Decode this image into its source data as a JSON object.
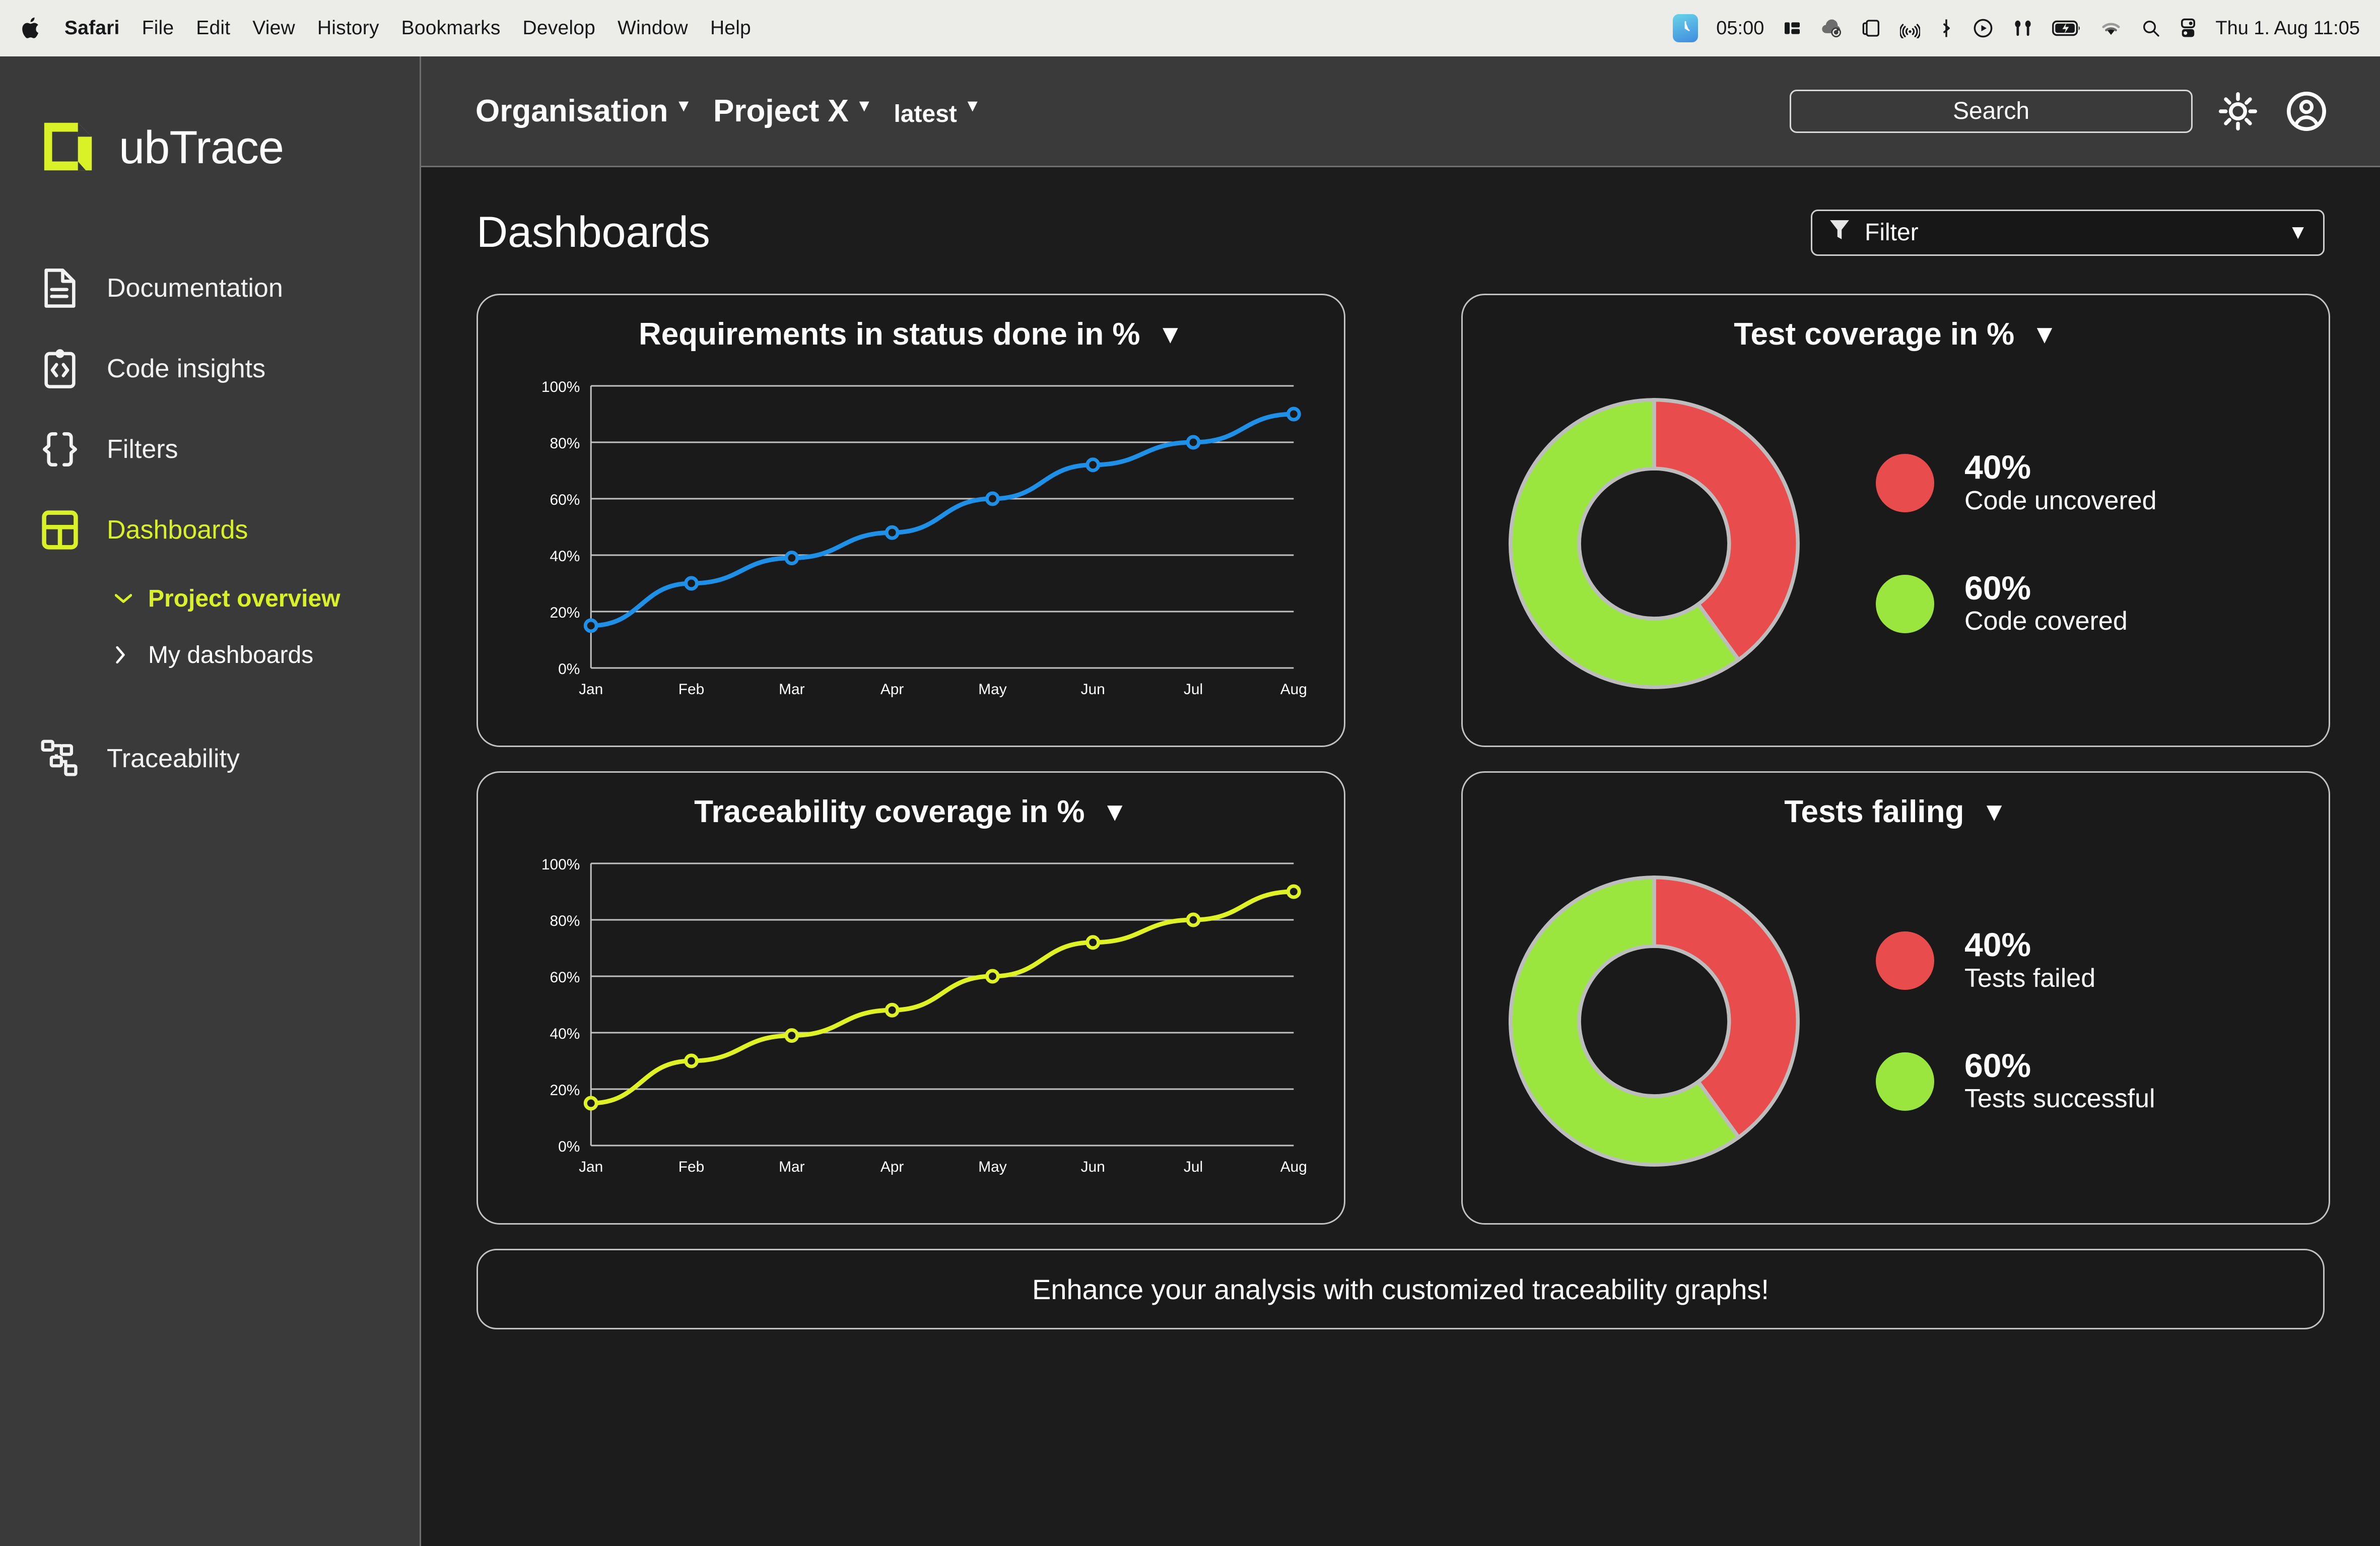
{
  "menubar": {
    "apple_icon": "apple-icon",
    "items": [
      {
        "label": "Safari",
        "bold": true
      },
      {
        "label": "File",
        "bold": false
      },
      {
        "label": "Edit",
        "bold": false
      },
      {
        "label": "View",
        "bold": false
      },
      {
        "label": "History",
        "bold": false
      },
      {
        "label": "Bookmarks",
        "bold": false
      },
      {
        "label": "Develop",
        "bold": false
      },
      {
        "label": "Window",
        "bold": false
      },
      {
        "label": "Help",
        "bold": false
      }
    ],
    "status": {
      "timer_value": "05:00",
      "icons": [
        "stage-manager-icon",
        "cloud-sync-icon",
        "screen-mirroring-icon",
        "airplay-icon",
        "bluetooth-icon",
        "now-playing-icon",
        "airpods-icon",
        "battery-charging-icon",
        "wifi-icon",
        "spotlight-search-icon",
        "control-center-icon"
      ],
      "datetime": "Thu 1. Aug 11:05"
    }
  },
  "brand": {
    "name": "ubTrace",
    "logo_icon": "ubtrace-cube-logo",
    "accent_color": "#d9f227"
  },
  "sidebar": {
    "items": [
      {
        "label": "Documentation",
        "icon": "document-icon",
        "active": false
      },
      {
        "label": "Code insights",
        "icon": "code-clipboard-icon",
        "active": false
      },
      {
        "label": "Filters",
        "icon": "curly-braces-icon",
        "active": false
      },
      {
        "label": "Dashboards",
        "icon": "dashboard-grid-icon",
        "active": true
      },
      {
        "label": "Traceability",
        "icon": "node-graph-icon",
        "active": false
      }
    ],
    "dashboards_children": [
      {
        "label": "Project overview",
        "chevron": "chevron-down-icon",
        "active": true
      },
      {
        "label": "My dashboards",
        "chevron": "chevron-right-icon",
        "active": false
      }
    ]
  },
  "topbar": {
    "breadcrumbs": [
      {
        "label": "Organisation",
        "caret": "caret-down-icon",
        "size": "large"
      },
      {
        "label": "Project X",
        "caret": "caret-down-icon",
        "size": "large"
      },
      {
        "label": "latest",
        "caret": "caret-down-icon",
        "size": "small"
      }
    ],
    "search_placeholder": "Search",
    "search_value": "",
    "theme_toggle_icon": "sun-icon",
    "account_icon": "account-avatar-icon"
  },
  "main": {
    "page_title": "Dashboards",
    "filter": {
      "label": "Filter",
      "icon": "funnel-icon",
      "caret": "caret-down-icon"
    },
    "banner_text": "Enhance your analysis with customized traceability graphs!"
  },
  "cards": {
    "requirements": {
      "title": "Requirements in status done in %",
      "caret": "caret-down-icon"
    },
    "test_coverage": {
      "title": "Test coverage in %",
      "caret": "caret-down-icon"
    },
    "traceability": {
      "title": "Traceability coverage in %",
      "caret": "caret-down-icon"
    },
    "tests_failing": {
      "title": "Tests failing",
      "caret": "caret-down-icon"
    }
  },
  "chart_data": [
    {
      "type": "line",
      "id": "requirements",
      "title": "Requirements in status done in %",
      "xlabel": "",
      "ylabel": "",
      "categories": [
        "Jan",
        "Feb",
        "Mar",
        "Apr",
        "May",
        "Jun",
        "Jul",
        "Aug"
      ],
      "values": [
        15,
        30,
        39,
        48,
        60,
        72,
        80,
        90
      ],
      "ytick_labels": [
        "0%",
        "20%",
        "40%",
        "60%",
        "80%",
        "100%"
      ],
      "yticks": [
        0,
        20,
        40,
        60,
        80,
        100
      ],
      "ylim": [
        0,
        100
      ],
      "grid": true,
      "legend": "none",
      "color": "#1e90e8",
      "marker": "open-circle"
    },
    {
      "type": "pie",
      "id": "test_coverage",
      "title": "Test coverage in %",
      "donut": true,
      "labels": [
        "Code uncovered",
        "Code covered"
      ],
      "values": [
        40,
        60
      ],
      "value_labels": [
        "40%",
        "60%"
      ],
      "colors": [
        "#e84c4c",
        "#9ae63f"
      ],
      "legend": "right"
    },
    {
      "type": "line",
      "id": "traceability",
      "title": "Traceability coverage in %",
      "xlabel": "",
      "ylabel": "",
      "categories": [
        "Jan",
        "Feb",
        "Mar",
        "Apr",
        "May",
        "Jun",
        "Jul",
        "Aug"
      ],
      "values": [
        15,
        30,
        39,
        48,
        60,
        72,
        80,
        90
      ],
      "ytick_labels": [
        "0%",
        "20%",
        "40%",
        "60%",
        "80%",
        "100%"
      ],
      "yticks": [
        0,
        20,
        40,
        60,
        80,
        100
      ],
      "ylim": [
        0,
        100
      ],
      "grid": true,
      "legend": "none",
      "color": "#dff224",
      "marker": "open-circle"
    },
    {
      "type": "pie",
      "id": "tests_failing",
      "title": "Tests failing",
      "donut": true,
      "labels": [
        "Tests failed",
        "Tests successful"
      ],
      "values": [
        40,
        60
      ],
      "value_labels": [
        "40%",
        "60%"
      ],
      "colors": [
        "#e84c4c",
        "#9ae63f"
      ],
      "legend": "right"
    }
  ]
}
